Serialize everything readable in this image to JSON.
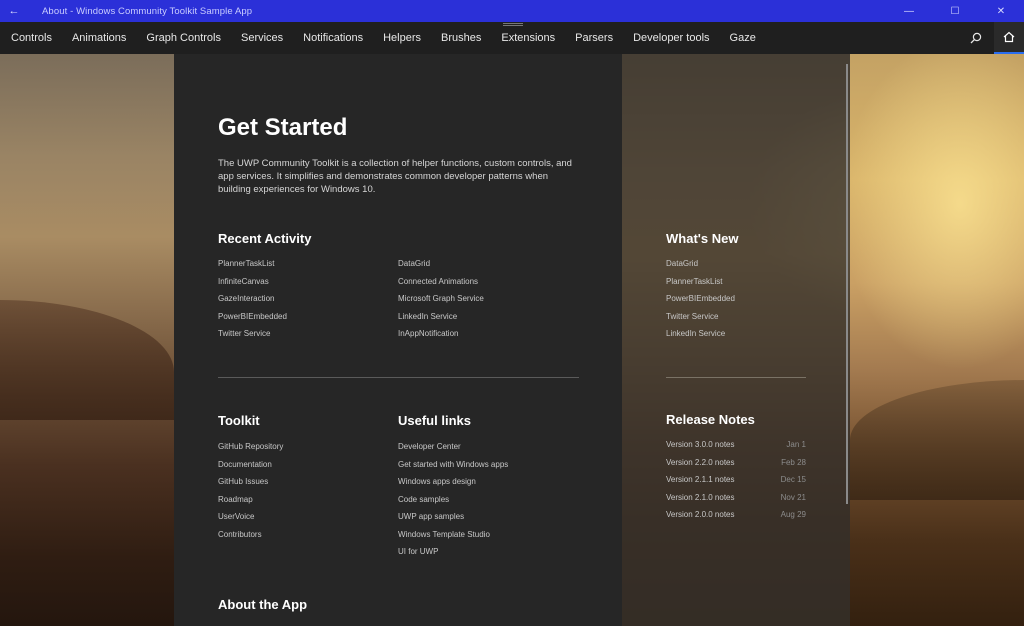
{
  "window": {
    "title": "About - Windows Community Toolkit Sample App",
    "back_glyph": "←",
    "minimize_glyph": "—",
    "maximize_glyph": "☐",
    "close_glyph": "✕"
  },
  "nav": {
    "items": [
      "Controls",
      "Animations",
      "Graph Controls",
      "Services",
      "Notifications",
      "Helpers",
      "Brushes",
      "Extensions",
      "Parsers",
      "Developer tools",
      "Gaze"
    ],
    "search_icon": "search-icon",
    "home_icon": "home-icon",
    "accent_color": "#2b6ef0"
  },
  "titlebar_color": "#2b30d8",
  "main": {
    "title": "Get Started",
    "intro": "The UWP Community Toolkit is a collection of helper functions, custom controls, and app services. It simplifies and demonstrates common developer patterns when building experiences for Windows 10.",
    "recent_activity": {
      "title": "Recent Activity",
      "col1": [
        "PlannerTaskList",
        "InfiniteCanvas",
        "GazeInteraction",
        "PowerBIEmbedded",
        "Twitter Service"
      ],
      "col2": [
        "DataGrid",
        "Connected Animations",
        "Microsoft Graph Service",
        "LinkedIn Service",
        "InAppNotification"
      ]
    },
    "toolkit": {
      "title": "Toolkit",
      "items": [
        "GitHub Repository",
        "Documentation",
        "GitHub Issues",
        "Roadmap",
        "UserVoice",
        "Contributors"
      ]
    },
    "useful_links": {
      "title": "Useful links",
      "items": [
        "Developer Center",
        "Get started with Windows apps",
        "Windows apps design",
        "Code samples",
        "UWP app samples",
        "Windows Template Studio",
        "UI for UWP"
      ]
    },
    "about": {
      "title": "About the App"
    }
  },
  "side": {
    "whats_new": {
      "title": "What's New",
      "items": [
        "DataGrid",
        "PlannerTaskList",
        "PowerBIEmbedded",
        "Twitter Service",
        "LinkedIn Service"
      ]
    },
    "release_notes": {
      "title": "Release Notes",
      "items": [
        {
          "label": "Version 3.0.0 notes",
          "date": "Jan 1"
        },
        {
          "label": "Version 2.2.0 notes",
          "date": "Feb 28"
        },
        {
          "label": "Version 2.1.1 notes",
          "date": "Dec 15"
        },
        {
          "label": "Version 2.1.0 notes",
          "date": "Nov 21"
        },
        {
          "label": "Version 2.0.0 notes",
          "date": "Aug 29"
        }
      ]
    }
  }
}
